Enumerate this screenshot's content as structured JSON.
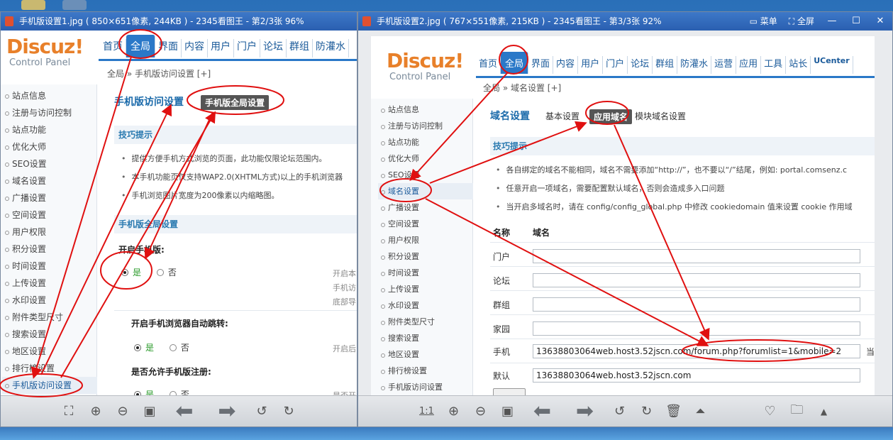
{
  "colors": {
    "accent": "#2a78c8",
    "annotation": "#e01010",
    "logo": "#e8802a"
  },
  "left_window": {
    "title": "手机版设置1.jpg ( 850×651像素, 244KB ) - 2345看图王 - 第2/3张 96%",
    "logo": "Discuz!",
    "logo_sub": "Control Panel",
    "nav": [
      "首页",
      "全局",
      "界面",
      "内容",
      "用户",
      "门户",
      "论坛",
      "群组",
      "防灌水"
    ],
    "breadcrumb": "全局 » 手机版访问设置  [+]",
    "sidebar": [
      "站点信息",
      "注册与访问控制",
      "站点功能",
      "优化大师",
      "SEO设置",
      "域名设置",
      "广播设置",
      "空间设置",
      "用户权限",
      "积分设置",
      "时间设置",
      "上传设置",
      "水印设置",
      "附件类型尺寸",
      "搜索设置",
      "地区设置",
      "排行榜设置",
      "手机版访问设置"
    ],
    "page_title": "手机版访问设置",
    "tab": "手机版全局设置",
    "tips_title": "技巧提示",
    "tips": [
      "提供方便手机方式浏览的页面，此功能仅限论坛范围内。",
      "本手机功能页仅支持WAP2.0(XHTML方式)以上的手机浏览器",
      "手机浏览图片宽度为200像素以内缩略图。"
    ],
    "global_title": "手机版全局设置",
    "opt1": "开启手机版:",
    "opt1_hints": [
      "开启本",
      "手机访",
      "底部导"
    ],
    "opt2": "开启手机浏览器自动跳转:",
    "opt2_hint": "开启后",
    "opt3": "是否允许手机版注册:",
    "opt3_hint": "是否开",
    "yes": "是",
    "no": "否"
  },
  "right_window": {
    "title": "手机版设置2.jpg ( 767×551像素, 215KB ) - 2345看图王 - 第3/3张 92%",
    "menu_label": "菜单",
    "fullscreen_label": "全屏",
    "logo": "Discuz!",
    "logo_sub": "Control Panel",
    "nav": [
      "首页",
      "全局",
      "界面",
      "内容",
      "用户",
      "门户",
      "论坛",
      "群组",
      "防灌水",
      "运营",
      "应用",
      "工具",
      "站长",
      "UCenter"
    ],
    "breadcrumb": "全局 » 域名设置  [+]",
    "sidebar": [
      "站点信息",
      "注册与访问控制",
      "站点功能",
      "优化大师",
      "SEO设置",
      "域名设置",
      "广播设置",
      "空间设置",
      "用户权限",
      "积分设置",
      "时间设置",
      "上传设置",
      "水印设置",
      "附件类型尺寸",
      "搜索设置",
      "地区设置",
      "排行榜设置",
      "手机版访问设置"
    ],
    "page_title": "域名设置",
    "tab_basic": "基本设置",
    "tab_active": "应用域名",
    "tab_module": "模块域名设置",
    "tips_title": "技巧提示",
    "tips": [
      "各自绑定的域名不能相同，域名不需要添加“http://”，也不要以“/”结尾，例如: portal.comsenz.c",
      "任意开启一项域名，需要配置默认域名，否则会造成多入口问题",
      "当开启多域名时，请在  config/config_global.php  中修改  cookiedomain  值来设置  cookie  作用域"
    ],
    "col_name": "名称",
    "col_domain": "域名",
    "rows": [
      {
        "name": "门户",
        "value": ""
      },
      {
        "name": "论坛",
        "value": ""
      },
      {
        "name": "群组",
        "value": ""
      },
      {
        "name": "家园",
        "value": ""
      },
      {
        "name": "手机",
        "value": "13638803064web.host3.52jscn.com/forum.php?forumlist=1&mobile=2"
      },
      {
        "name": "默认",
        "value": "13638803064web.host3.52jscn.com"
      }
    ],
    "mobile_suffix": "当",
    "zoom_label": "1:1"
  }
}
